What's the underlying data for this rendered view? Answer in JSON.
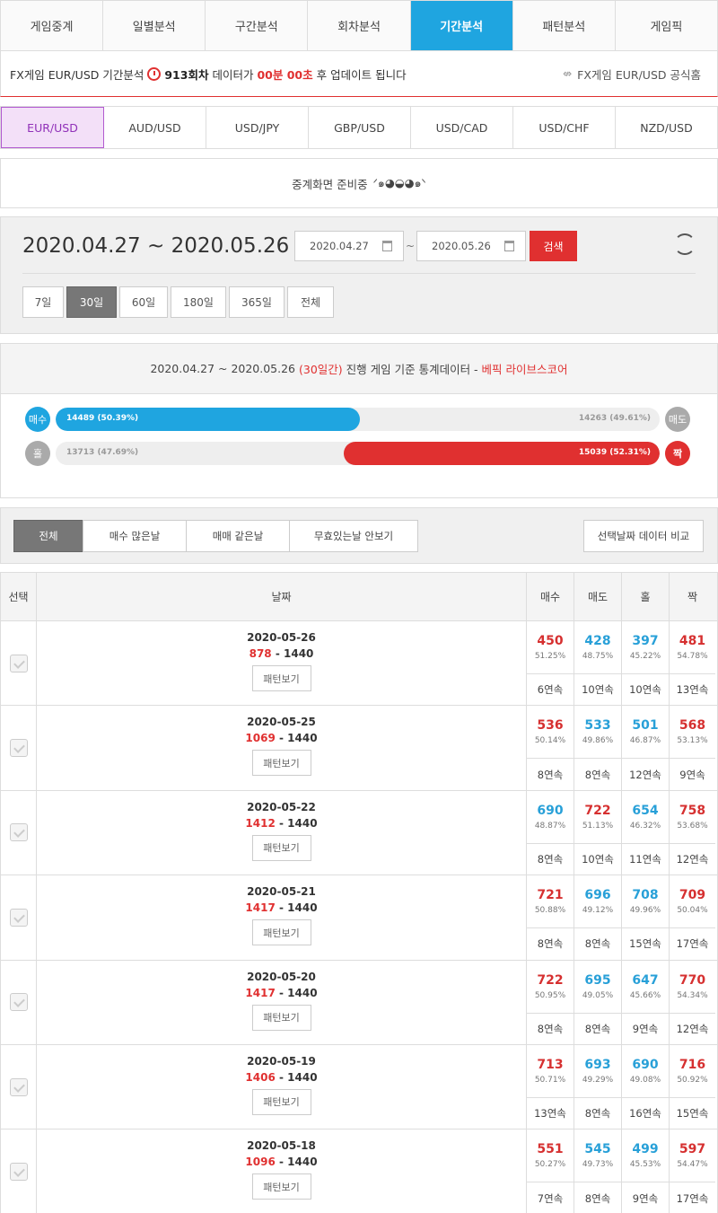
{
  "nav": [
    "게임중계",
    "일별분석",
    "구간분석",
    "회차분석",
    "기간분석",
    "패턴분석",
    "게임픽"
  ],
  "nav_active": 4,
  "info": {
    "prefix": "FX게임 EUR/USD 기간분석",
    "round": "913회차",
    "mid": "데이터가",
    "timer": "00분 00초",
    "suffix": "후 업데이트 됩니다",
    "official": "FX게임 EUR/USD 공식홈"
  },
  "pairs": [
    "EUR/USD",
    "AUD/USD",
    "USD/JPY",
    "GBP/USD",
    "USD/CAD",
    "USD/CHF",
    "NZD/USD"
  ],
  "pair_active": 0,
  "prepare_text": "중계화면 준비중",
  "prepare_dots": "ᐟ๑◕◒◕๑ᐠ",
  "date": {
    "range": "2020.04.27 ~ 2020.05.26",
    "from": "2020.04.27",
    "to": "2020.05.26",
    "tilde": "~",
    "search": "검색",
    "periods": [
      "7일",
      "30일",
      "60일",
      "180일",
      "365일",
      "전체"
    ],
    "period_active": 1
  },
  "stats": {
    "range": "2020.04.27 ~ 2020.05.26",
    "days": "(30일간)",
    "desc": "진행 게임 기준 통계데이터 -",
    "source": "베픽 라이브스코어",
    "buy_label": "매수",
    "sell_label": "매도",
    "odd_label": "홀",
    "even_label": "짝",
    "buy_text": "14489 (50.39%)",
    "sell_text": "14263 (49.61%)",
    "buy_pct": 50.39,
    "odd_text": "13713 (47.69%)",
    "even_text": "15039 (52.31%)",
    "even_pct": 52.31,
    "colors": {
      "blue": "#1fa5e0",
      "red": "#e03030"
    }
  },
  "filters": [
    "전체",
    "매수 많은날",
    "매매 같은날",
    "무효있는날 안보기"
  ],
  "filter_active": 0,
  "compare": "선택날짜 데이터 비교",
  "table": {
    "headers": [
      "선택",
      "날짜",
      "매수",
      "매도",
      "홀",
      "짝"
    ],
    "pattern_label": "패턴보기",
    "rows": [
      {
        "date": "2020-05-26",
        "count": "878",
        "total": "1440",
        "v": [
          [
            "450",
            "51.25%",
            "6연속",
            "r"
          ],
          [
            "428",
            "48.75%",
            "10연속",
            "b"
          ],
          [
            "397",
            "45.22%",
            "10연속",
            "b"
          ],
          [
            "481",
            "54.78%",
            "13연속",
            "r"
          ]
        ]
      },
      {
        "date": "2020-05-25",
        "count": "1069",
        "total": "1440",
        "v": [
          [
            "536",
            "50.14%",
            "8연속",
            "r"
          ],
          [
            "533",
            "49.86%",
            "8연속",
            "b"
          ],
          [
            "501",
            "46.87%",
            "12연속",
            "b"
          ],
          [
            "568",
            "53.13%",
            "9연속",
            "r"
          ]
        ]
      },
      {
        "date": "2020-05-22",
        "count": "1412",
        "total": "1440",
        "v": [
          [
            "690",
            "48.87%",
            "8연속",
            "b"
          ],
          [
            "722",
            "51.13%",
            "10연속",
            "r"
          ],
          [
            "654",
            "46.32%",
            "11연속",
            "b"
          ],
          [
            "758",
            "53.68%",
            "12연속",
            "r"
          ]
        ]
      },
      {
        "date": "2020-05-21",
        "count": "1417",
        "total": "1440",
        "v": [
          [
            "721",
            "50.88%",
            "8연속",
            "r"
          ],
          [
            "696",
            "49.12%",
            "8연속",
            "b"
          ],
          [
            "708",
            "49.96%",
            "15연속",
            "b"
          ],
          [
            "709",
            "50.04%",
            "17연속",
            "r"
          ]
        ]
      },
      {
        "date": "2020-05-20",
        "count": "1417",
        "total": "1440",
        "v": [
          [
            "722",
            "50.95%",
            "8연속",
            "r"
          ],
          [
            "695",
            "49.05%",
            "8연속",
            "b"
          ],
          [
            "647",
            "45.66%",
            "9연속",
            "b"
          ],
          [
            "770",
            "54.34%",
            "12연속",
            "r"
          ]
        ]
      },
      {
        "date": "2020-05-19",
        "count": "1406",
        "total": "1440",
        "v": [
          [
            "713",
            "50.71%",
            "13연속",
            "r"
          ],
          [
            "693",
            "49.29%",
            "8연속",
            "b"
          ],
          [
            "690",
            "49.08%",
            "16연속",
            "b"
          ],
          [
            "716",
            "50.92%",
            "15연속",
            "r"
          ]
        ]
      },
      {
        "date": "2020-05-18",
        "count": "1096",
        "total": "1440",
        "v": [
          [
            "551",
            "50.27%",
            "7연속",
            "r"
          ],
          [
            "545",
            "49.73%",
            "8연속",
            "b"
          ],
          [
            "499",
            "45.53%",
            "9연속",
            "b"
          ],
          [
            "597",
            "54.47%",
            "17연속",
            "r"
          ]
        ]
      }
    ]
  }
}
